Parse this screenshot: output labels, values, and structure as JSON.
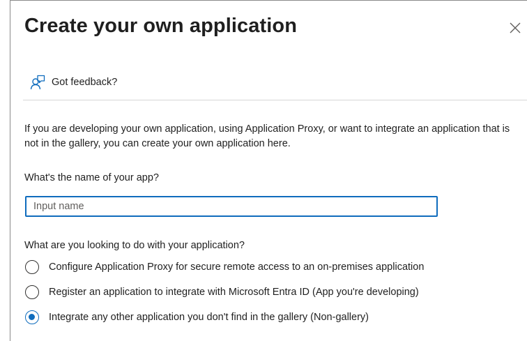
{
  "dialog": {
    "title": "Create your own application"
  },
  "feedback": {
    "label": "Got feedback?"
  },
  "intro": {
    "text": "If you are developing your own application, using Application Proxy, or want to integrate an application that is not in the gallery, you can create your own application here."
  },
  "app_name": {
    "label": "What's the name of your app?",
    "placeholder": "Input name",
    "value": ""
  },
  "purpose": {
    "label": "What are you looking to do with your application?",
    "options": [
      {
        "label": "Configure Application Proxy for secure remote access to an on-premises application",
        "selected": false
      },
      {
        "label": "Register an application to integrate with Microsoft Entra ID (App you're developing)",
        "selected": false
      },
      {
        "label": "Integrate any other application you don't find in the gallery (Non-gallery)",
        "selected": true
      }
    ]
  },
  "icons": {
    "close": "close-icon",
    "feedback": "feedback-person-icon"
  },
  "colors": {
    "accent": "#0f6cbd",
    "text": "#1f1f1f",
    "divider": "#d6d6d6"
  }
}
